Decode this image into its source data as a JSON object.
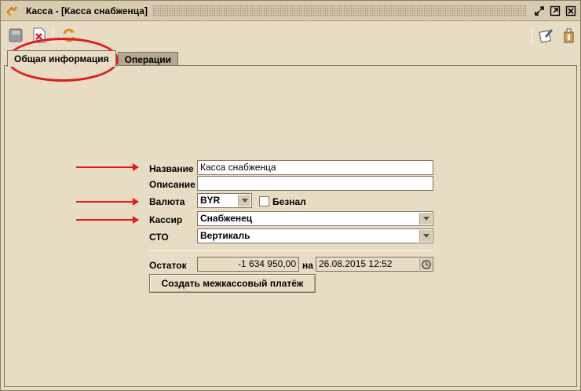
{
  "window": {
    "title": "Касса - [Касса снабженца]"
  },
  "tabs": [
    {
      "label": "Общая информация",
      "active": true
    },
    {
      "label": "Операции",
      "active": false
    }
  ],
  "form": {
    "name_label": "Название",
    "name_value": "Касса снабженца",
    "description_label": "Описание",
    "description_value": "",
    "currency_label": "Валюта",
    "currency_value": "BYR",
    "cashless_label": "Безнал",
    "cashless_checked": false,
    "cashier_label": "Кассир",
    "cashier_value": "Снабженец",
    "sto_label": "СТО",
    "sto_value": "Вертикаль",
    "balance_label": "Остаток",
    "balance_value": "-1 634 950,00",
    "on_label": "на",
    "date_value": "26.08.2015 12:52",
    "create_payment_label": "Создать межкассовый платёж"
  },
  "colors": {
    "background": "#e8dcc4",
    "annotation_red": "#e01c1c"
  },
  "icons": [
    "app-icon",
    "restore-icon",
    "maximize-icon",
    "close-icon",
    "save-icon",
    "delete-document-icon",
    "refresh-icon",
    "edit-notes-icon",
    "info-icon",
    "calendar-clock-icon",
    "dropdown-arrow-icon"
  ]
}
